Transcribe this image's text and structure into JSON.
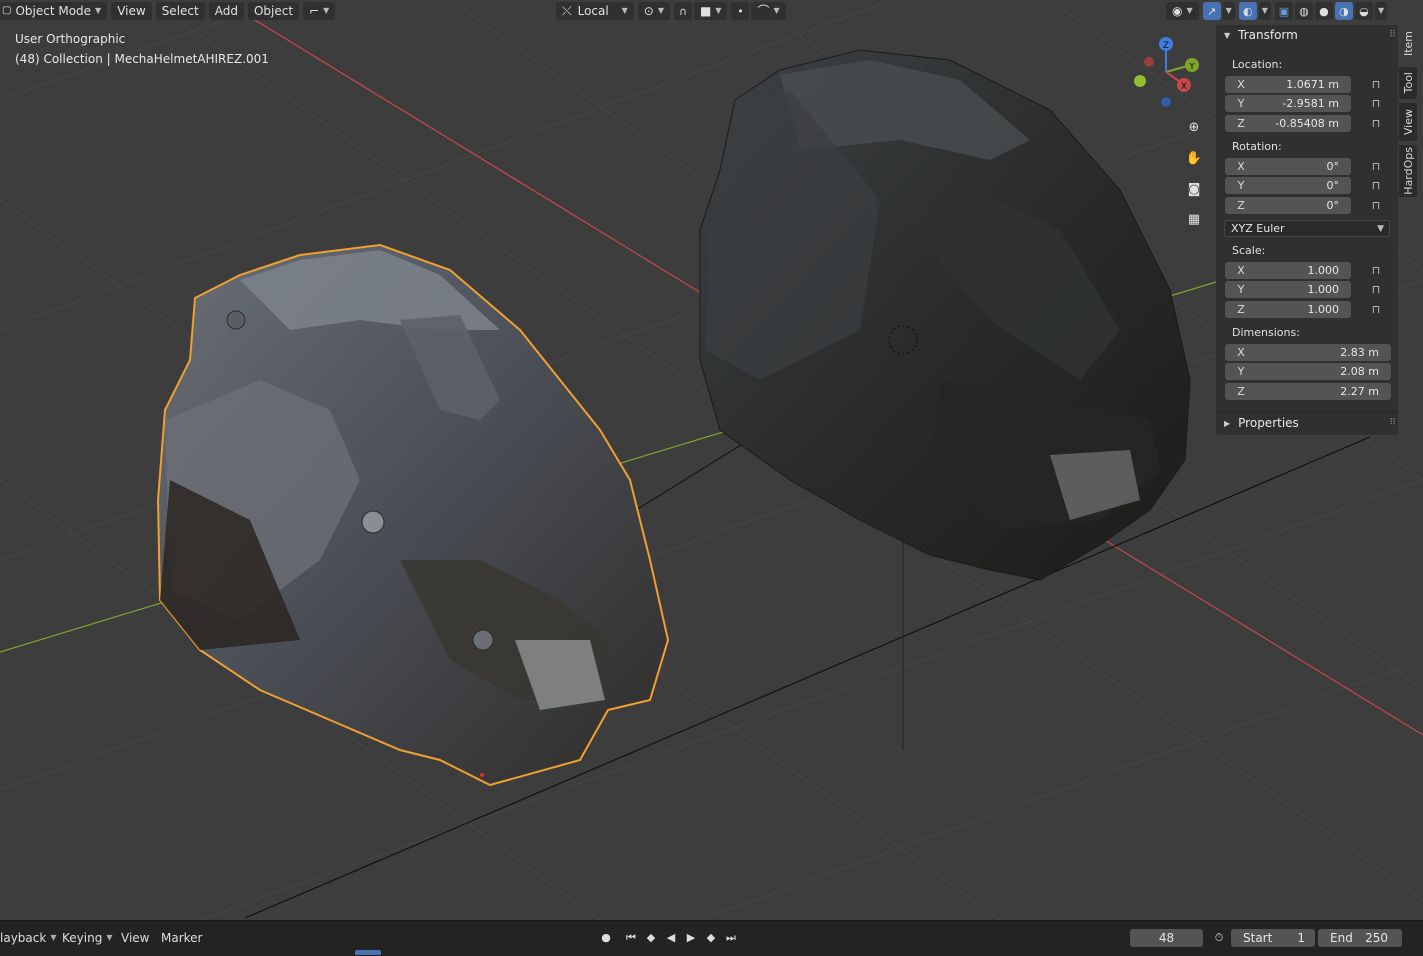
{
  "header": {
    "mode": "Object Mode",
    "menus": [
      "View",
      "Select",
      "Add",
      "Object"
    ],
    "transform_orientation": "Local"
  },
  "viewport": {
    "view_name": "User Orthographic",
    "collection_info": "(48) Collection | MechaHelmetAHIREZ.001"
  },
  "gizmo": {
    "x": "X",
    "y": "Y",
    "z": "Z"
  },
  "sidebar_tabs": [
    "Item",
    "Tool",
    "View",
    "HardOps"
  ],
  "transform": {
    "title": "Transform",
    "location_label": "Location:",
    "location": [
      {
        "axis": "X",
        "value": "1.0671 m"
      },
      {
        "axis": "Y",
        "value": "-2.9581 m"
      },
      {
        "axis": "Z",
        "value": "-0.85408 m"
      }
    ],
    "rotation_label": "Rotation:",
    "rotation": [
      {
        "axis": "X",
        "value": "0°"
      },
      {
        "axis": "Y",
        "value": "0°"
      },
      {
        "axis": "Z",
        "value": "0°"
      }
    ],
    "rotation_mode": "XYZ Euler",
    "scale_label": "Scale:",
    "scale": [
      {
        "axis": "X",
        "value": "1.000"
      },
      {
        "axis": "Y",
        "value": "1.000"
      },
      {
        "axis": "Z",
        "value": "1.000"
      }
    ],
    "dimensions_label": "Dimensions:",
    "dimensions": [
      {
        "axis": "X",
        "value": "2.83 m"
      },
      {
        "axis": "Y",
        "value": "2.08 m"
      },
      {
        "axis": "Z",
        "value": "2.27 m"
      }
    ]
  },
  "properties": {
    "title": "Properties"
  },
  "timeline": {
    "menus": [
      "layback",
      "Keying",
      "View",
      "Marker"
    ],
    "current_frame": "48",
    "start_label": "Start",
    "start_value": "1",
    "end_label": "End",
    "end_value": "250"
  },
  "colors": {
    "accent": "#4772b3",
    "selection_outline": "#f0a030",
    "x_axis": "#c74848",
    "y_axis": "#7ea52a",
    "z_axis": "#3f7de0"
  }
}
